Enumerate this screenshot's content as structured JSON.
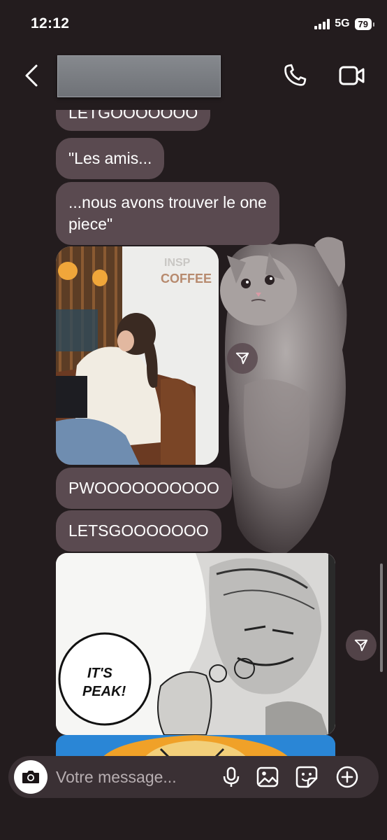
{
  "status_bar": {
    "time": "12:12",
    "network": "5G",
    "battery": "79"
  },
  "messages": [
    {
      "text": "LETGOOOOOOO"
    },
    {
      "text": "\"Les amis..."
    },
    {
      "text": "...nous avons trouver le one",
      "text2": "piece\""
    },
    {
      "text": "PWOOOOOOOOOO"
    },
    {
      "text": "LETSGOOOOOOO"
    }
  ],
  "photo": {
    "sign_line1": "INSP",
    "sign_line2": "COFFEE"
  },
  "manga": {
    "speech_line1": "IT'S",
    "speech_line2": "PEAK!"
  },
  "composer": {
    "placeholder": "Votre message..."
  },
  "icons": {
    "back": "chevron-left-icon",
    "call": "phone-icon",
    "video": "video-camera-icon",
    "share": "send-icon",
    "camera": "camera-icon",
    "mic": "microphone-icon",
    "gallery": "image-icon",
    "sticker": "sticker-icon",
    "add": "plus-circle-icon"
  },
  "colors": {
    "background": "#231c1e",
    "bubble": "#5a4a50",
    "composer": "#3a3034"
  }
}
